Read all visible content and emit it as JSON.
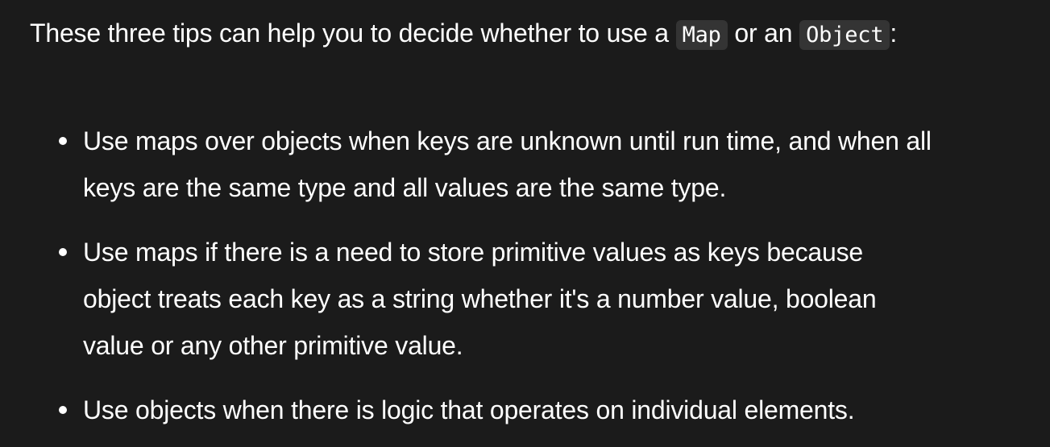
{
  "intro": {
    "text_before": "These three tips can help you to decide whether to use a ",
    "code_map": "Map",
    "text_middle": " or an ",
    "code_object": "Object",
    "text_after": ":"
  },
  "tips": [
    {
      "lines": [
        "Use maps over objects when keys are unknown until run time, and when all",
        "keys are the same type and all values are the same type."
      ]
    },
    {
      "lines": [
        "Use maps if there is a need to store primitive values as keys because",
        "object treats each key as a string whether it's a number value, boolean",
        "value or any other primitive value."
      ]
    },
    {
      "lines": [
        "Use objects when there is logic that operates on individual elements."
      ]
    }
  ]
}
